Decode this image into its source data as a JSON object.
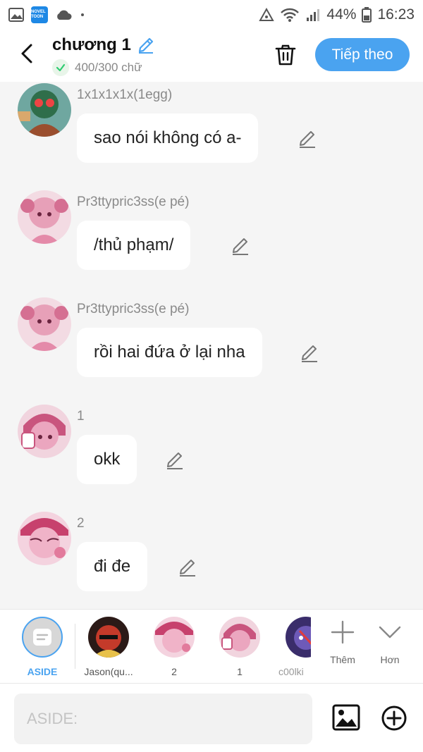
{
  "status_bar": {
    "battery": "44%",
    "time": "16:23",
    "app_logo_text": "NOVEL TOON",
    "icons": [
      "gallery-icon",
      "novel-toon-icon",
      "cloud-icon",
      "dot-icon",
      "data-saver-icon",
      "wifi-icon",
      "signal-icon",
      "battery-icon"
    ]
  },
  "header": {
    "title": "chương 1",
    "word_count": "400/300 chữ",
    "next_button": "Tiếp theo",
    "icons": [
      "back-icon",
      "pencil-icon",
      "check-icon",
      "trash-icon"
    ]
  },
  "messages": [
    {
      "name": "1x1x1x1x(1egg)",
      "text": "sao nói không có a-",
      "avatar": "green"
    },
    {
      "name": "Pr3ttypric3ss(e pé)",
      "text": "/thủ phạm/",
      "avatar": "pink"
    },
    {
      "name": "Pr3ttypric3ss(e pé)",
      "text": "rồi hai đứa ở lại nha",
      "avatar": "pink"
    },
    {
      "name": "1",
      "text": "okk",
      "avatar": "pink"
    },
    {
      "name": "2",
      "text": "đi đe",
      "avatar": "pink"
    }
  ],
  "characters": [
    {
      "label": "ASIDE",
      "selected": true
    },
    {
      "label": "Jason(qu...",
      "selected": false
    },
    {
      "label": "2",
      "selected": false
    },
    {
      "label": "1",
      "selected": false
    },
    {
      "label": "c00lki",
      "selected": false
    }
  ],
  "tools": {
    "more_label": "Thêm",
    "collapse_label": "Hơn"
  },
  "input": {
    "placeholder": "ASIDE:"
  },
  "colors": {
    "accent": "#4aa3f0",
    "bubble": "#ffffff",
    "background": "#f5f5f5",
    "check_green": "#2ecc71"
  }
}
